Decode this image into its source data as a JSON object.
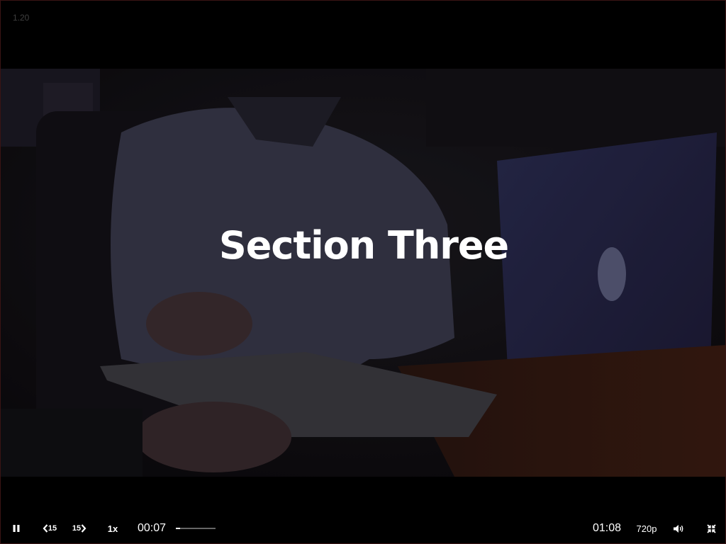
{
  "player": {
    "version": "1.20",
    "section_title": "Section Three",
    "controls": {
      "play_pause_icon": "pause-icon",
      "rewind_label": "15",
      "forward_label": "15",
      "speed_label": "1x",
      "current_time": "00:07",
      "duration": "01:08",
      "quality_label": "720p",
      "volume_icon": "volume-icon",
      "fullscreen_icon": "exit-fullscreen-icon",
      "progress_fraction": 0.1
    }
  },
  "colors": {
    "background": "#000000",
    "text": "#ffffff",
    "frame_border": "#3a1414"
  }
}
